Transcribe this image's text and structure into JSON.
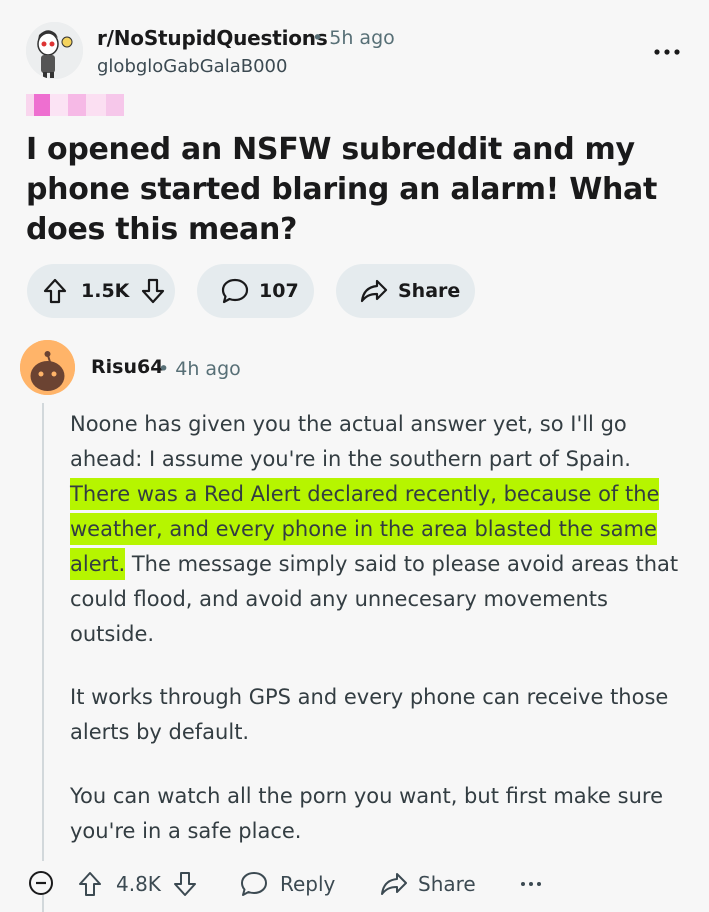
{
  "post": {
    "subreddit": "r/NoStupidQuestions",
    "separator": "•",
    "time": "5h ago",
    "author": "globgloGabGalaB000",
    "title": "I opened an NSFW subreddit and my phone started blaring an alarm! What does this mean?",
    "votes": "1.5K",
    "comments": "107",
    "share_label": "Share"
  },
  "comment": {
    "author": "Risu64",
    "separator": "•",
    "time": "4h ago",
    "p1_before": "Noone has given you the actual answer yet, so I'll go ahead: I assume you're in the southern part of Spain. ",
    "p1_highlight": "There was a Red Alert declared recently, because of the weather, and every phone in the area blasted the same alert.",
    "p1_after": " The message simply said to please avoid areas that could flood, and avoid any unnecesary movements outside.",
    "p2": "It works through GPS and every phone can receive those alerts by default.",
    "p3": "You can watch all the porn you want, but first make sure you're in a safe place.",
    "votes": "4.8K",
    "reply_label": "Reply",
    "share_label": "Share"
  },
  "icons": {
    "more": "ellipsis-icon",
    "upvote": "arrow-up-icon",
    "downvote": "arrow-down-icon",
    "comment": "speech-bubble-icon",
    "share": "share-arrow-icon",
    "collapse": "minus-circle-icon"
  },
  "colors": {
    "highlight": "#b6f500",
    "pill_bg": "#e5ebee",
    "avatar_orange": "#ffb469"
  }
}
